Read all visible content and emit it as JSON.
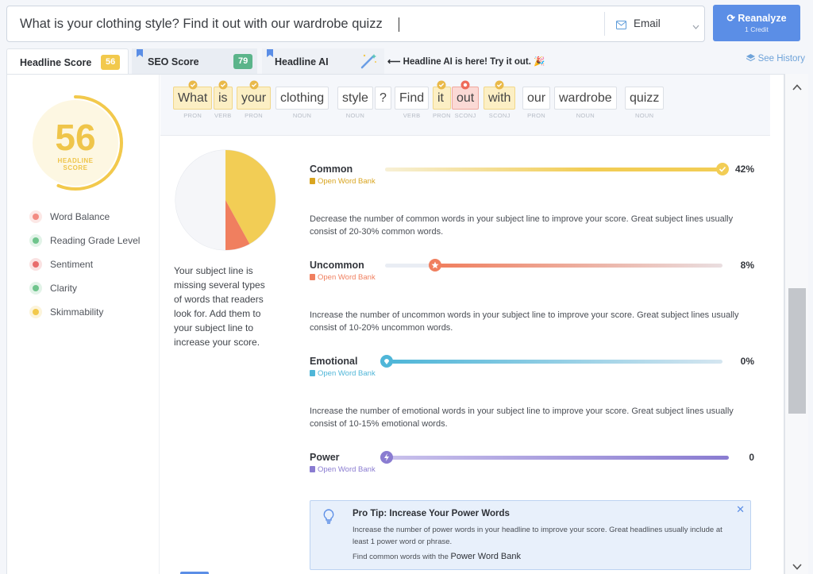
{
  "search": {
    "value": "What is your clothing style? Find it out with our wardrobe quizz",
    "type_label": "Email"
  },
  "reanalyze": {
    "label": "⟳ Reanalyze",
    "sub": "1 Credit"
  },
  "tabs": [
    {
      "label": "Headline Score",
      "badge": "56"
    },
    {
      "label": "SEO Score",
      "badge": "79"
    },
    {
      "label": "Headline AI"
    }
  ],
  "promo": "⟵ Headline AI is here! Try it out. 🎉",
  "see_history": "See History",
  "score": {
    "value": "56",
    "label_line1": "HEADLINE",
    "label_line2": "SCORE"
  },
  "sidebar": [
    {
      "label": "Word Balance",
      "color": "#f28b82"
    },
    {
      "label": "Reading Grade Level",
      "color": "#6fc48c"
    },
    {
      "label": "Sentiment",
      "color": "#e86c6c"
    },
    {
      "label": "Clarity",
      "color": "#6fc48c"
    },
    {
      "label": "Skimmability",
      "color": "#f2c94c"
    }
  ],
  "words": [
    {
      "text": "What",
      "pos": "PRON",
      "hl": "y"
    },
    {
      "text": "is",
      "pos": "VERB",
      "hl": "y"
    },
    {
      "text": "your",
      "pos": "PRON",
      "hl": "y"
    },
    {
      "text": "clothing",
      "pos": "NOUN",
      "hl": ""
    },
    {
      "text": "style",
      "pos": "NOUN",
      "hl": ""
    },
    {
      "text": "?",
      "pos": "",
      "hl": ""
    },
    {
      "text": "Find",
      "pos": "VERB",
      "hl": ""
    },
    {
      "text": "it",
      "pos": "PRON",
      "hl": "y"
    },
    {
      "text": "out",
      "pos": "SCONJ",
      "hl": "r"
    },
    {
      "text": "with",
      "pos": "SCONJ",
      "hl": "y"
    },
    {
      "text": "our",
      "pos": "PRON",
      "hl": ""
    },
    {
      "text": "wardrobe",
      "pos": "NOUN",
      "hl": ""
    },
    {
      "text": "quizz",
      "pos": "NOUN",
      "hl": ""
    }
  ],
  "balance_text": "Your subject line is missing several types of words that readers look for. Add them to your subject line to increase your score.",
  "chart_data": {
    "type": "pie",
    "slices": [
      {
        "label": "Common",
        "value": 42,
        "color": "#f2cd55"
      },
      {
        "label": "Uncommon",
        "value": 8,
        "color": "#f07f5f"
      },
      {
        "label": "Other",
        "value": 50,
        "color": "#f5f6f9"
      }
    ]
  },
  "rows": [
    {
      "title": "Common",
      "bank": "Open Word Bank",
      "pct": "42%",
      "level": 1.0,
      "color": "#f2cd55",
      "desc": "Decrease the number of common words in your subject line to improve your score. Great subject lines usually consist of 20-30% common words."
    },
    {
      "title": "Uncommon",
      "bank": "Open Word Bank",
      "pct": "8%",
      "level": 0.15,
      "color": "#f07f5f",
      "desc": "Increase the number of uncommon words in your subject line to improve your score. Great subject lines usually consist of 10-20% uncommon words."
    },
    {
      "title": "Emotional",
      "bank": "Open Word Bank",
      "pct": "0%",
      "level": 0.0,
      "color": "#4fb6d8",
      "desc": "Increase the number of emotional words in your subject line to improve your score. Great subject lines usually consist of 10-15% emotional words."
    },
    {
      "title": "Power",
      "bank": "Open Word Bank",
      "pct": "0",
      "level": 0.0,
      "color": "#8a7cd1",
      "desc": ""
    }
  ],
  "tip": {
    "title": "Pro Tip: Increase Your Power Words",
    "body": "Increase the number of power words in your headline to improve your score. Great headlines usually include at least 1 power word or phrase.",
    "foot": "Find common words with the ",
    "link": "Power Word Bank"
  }
}
